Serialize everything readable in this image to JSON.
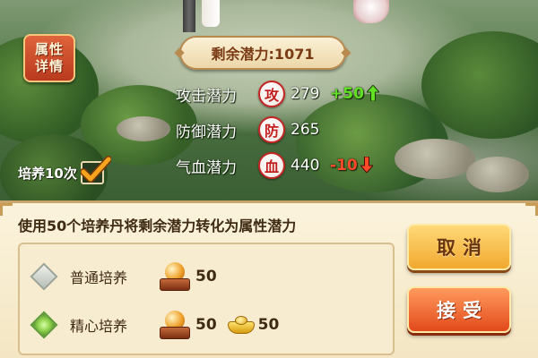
{
  "scene": {
    "attr_button": {
      "line1": "属性",
      "line2": "详情"
    },
    "remaining": "剩余潜力:1071",
    "stats": [
      {
        "label": "攻击潜力",
        "badge": "攻",
        "value": "279",
        "delta": "+50",
        "direction": "up"
      },
      {
        "label": "防御潜力",
        "badge": "防",
        "value": "265",
        "delta": "",
        "direction": "none"
      },
      {
        "label": "气血潜力",
        "badge": "血",
        "value": "440",
        "delta": "-10",
        "direction": "down"
      }
    ],
    "train10": {
      "label": "培养10次",
      "checked": true
    }
  },
  "panel": {
    "description": "使用50个培养丹将剩余潜力转化为属性潜力",
    "options": [
      {
        "name": "普通培养",
        "selected": false,
        "pill_cost": "50",
        "gold_cost": ""
      },
      {
        "name": "精心培养",
        "selected": true,
        "pill_cost": "50",
        "gold_cost": "50"
      }
    ],
    "cancel_label": "取消",
    "accept_label": "接受"
  },
  "colors": {
    "up": "#62e024",
    "down": "#ff4a2a",
    "accent": "#e24a1c"
  },
  "icons": [
    "attack-icon",
    "defense-icon",
    "hp-icon",
    "arrow-up-icon",
    "arrow-down-icon",
    "checkmark-icon",
    "training-pill-icon",
    "gold-ingot-icon"
  ]
}
